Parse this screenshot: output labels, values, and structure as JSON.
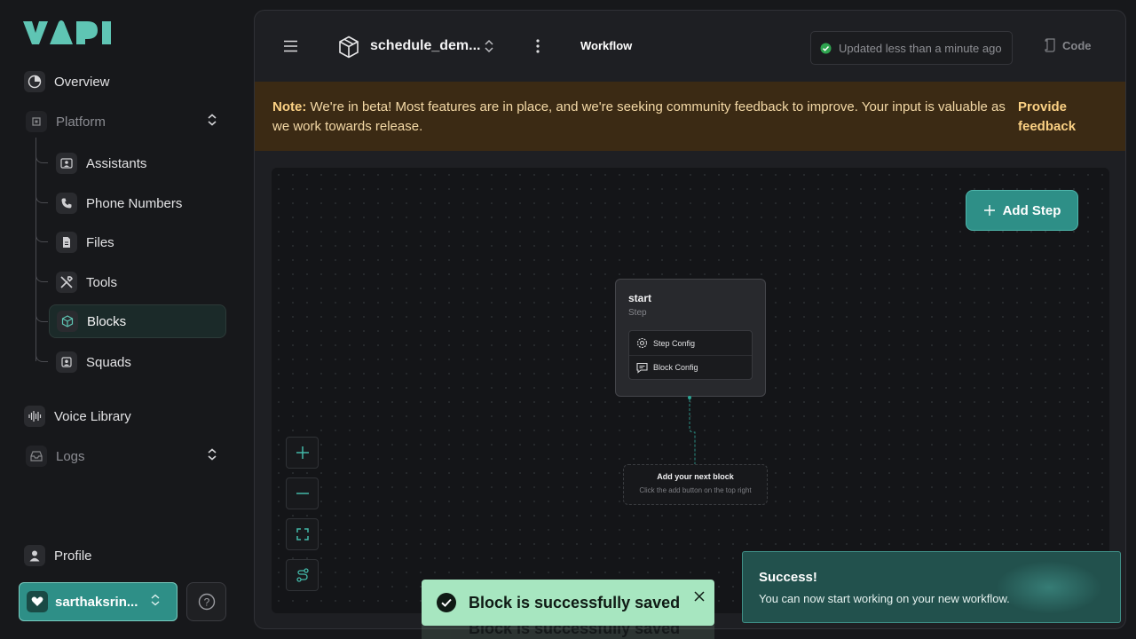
{
  "sidebar": {
    "logo_text": "VAPI",
    "overview": "Overview",
    "platform": "Platform",
    "items": [
      {
        "label": "Assistants"
      },
      {
        "label": "Phone Numbers"
      },
      {
        "label": "Files"
      },
      {
        "label": "Tools"
      },
      {
        "label": "Blocks"
      },
      {
        "label": "Squads"
      }
    ],
    "voice_library": "Voice Library",
    "logs": "Logs",
    "profile": "Profile",
    "user": "sarthaksrin..."
  },
  "header": {
    "block_name": "schedule_dem...",
    "tab": "Workflow",
    "status": "Updated less than a minute ago",
    "code": "Code"
  },
  "banner": {
    "label": "Note:",
    "text": "We're in beta! Most features are in place, and we're seeking community feedback to improve. Your input is valuable as we work towards release.",
    "link": "Provide feedback"
  },
  "canvas": {
    "add_step": "Add Step",
    "node": {
      "title": "start",
      "subtitle": "Step",
      "step_config": "Step Config",
      "block_config": "Block Config"
    },
    "next_block": {
      "title": "Add your next block",
      "hint": "Click the add button on the top right"
    }
  },
  "toasts": {
    "saved": "Block is successfully saved",
    "success_title": "Success!",
    "success_desc": "You can now start working on your new workflow."
  },
  "colors": {
    "accent": "#2e8f87",
    "banner_bg": "#3b2a14",
    "success_toast": "#a7e6c0"
  }
}
